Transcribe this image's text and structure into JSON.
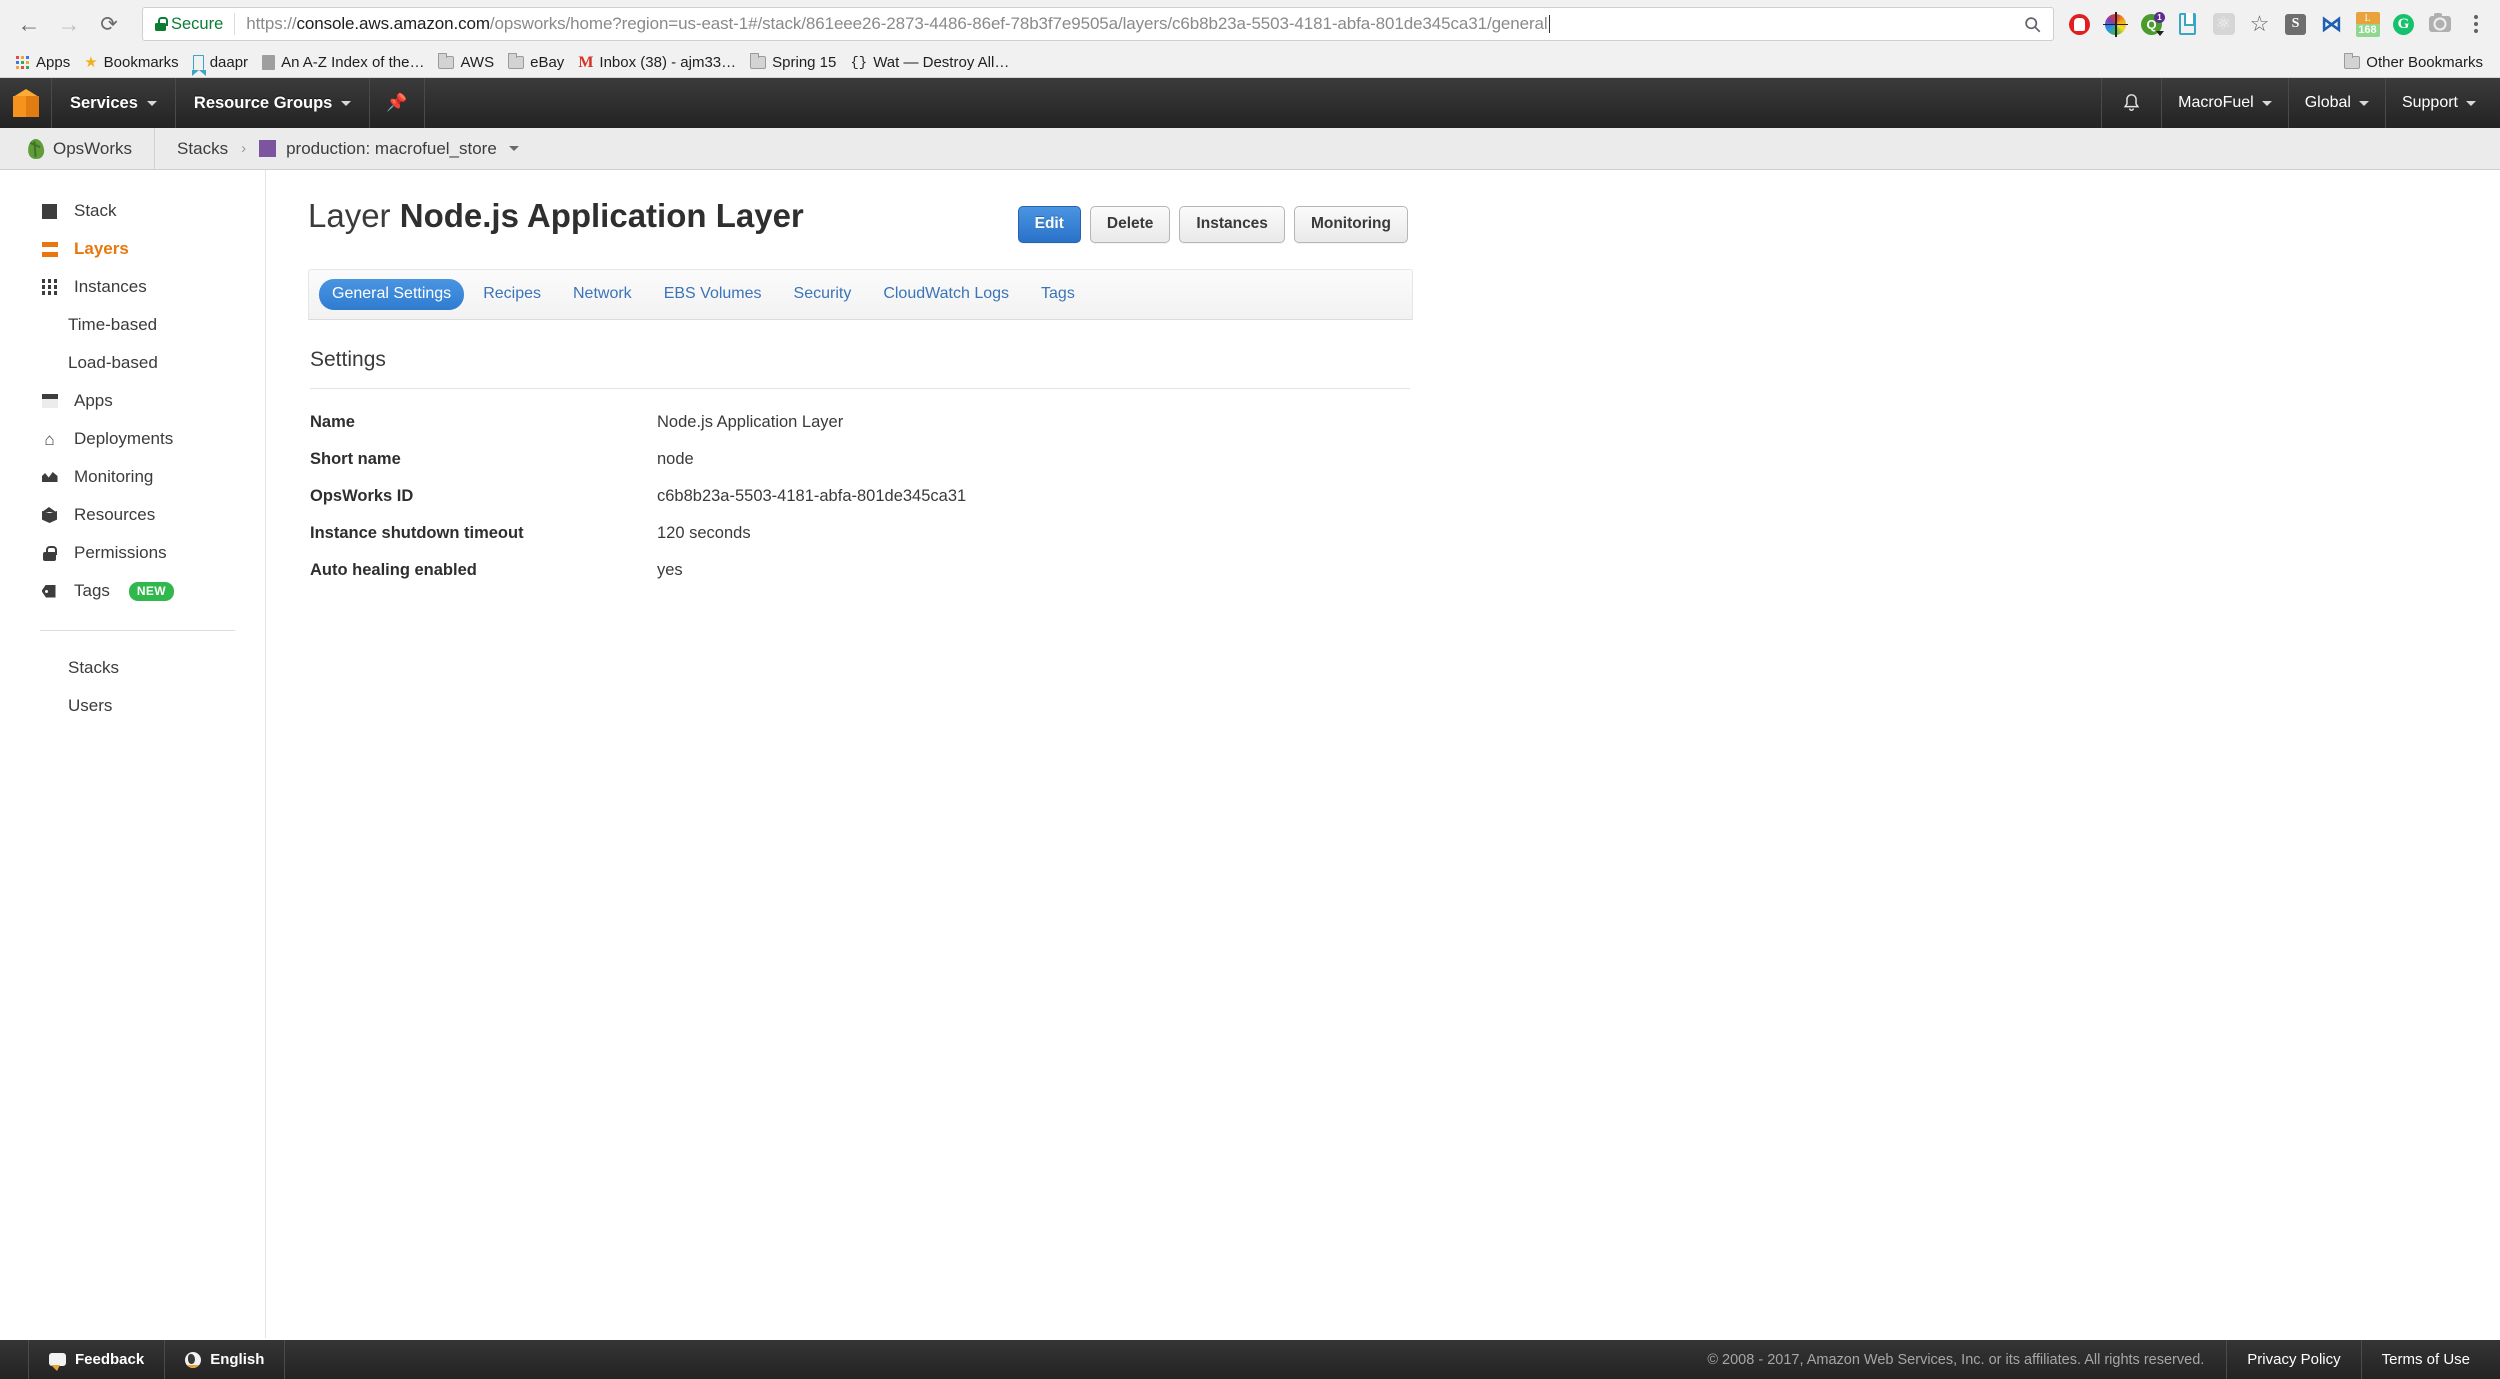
{
  "browser": {
    "back_icon": "←",
    "forward_icon": "→",
    "reload_icon": "⟳",
    "secure_label": "Secure",
    "url_host": "console.aws.amazon.com",
    "url_scheme": "https://",
    "url_path": "/opsworks/home?region=us-east-1#/stack/861eee26-2873-4486-86ef-78b3f7e9505a/layers/c6b8b23a-5503-4181-abfa-801de345ca31/general",
    "omnibox_search_icon": "search-icon",
    "extensions": [
      {
        "name": "adblock-stop-icon"
      },
      {
        "name": "color-picker-icon"
      },
      {
        "name": "quickbooks-icon",
        "badge": "1"
      },
      {
        "name": "pocket-bookmark-icon"
      },
      {
        "name": "react-devtools-icon",
        "glyph": "⚛"
      },
      {
        "name": "bookmark-star-icon",
        "glyph": "☆"
      },
      {
        "name": "scribd-icon",
        "glyph": "S"
      },
      {
        "name": "crossbrowser-icon",
        "glyph": "⋈"
      },
      {
        "name": "lastpass-icon",
        "glyph": "L",
        "badge": "168"
      },
      {
        "name": "grammarly-icon",
        "glyph": "G"
      },
      {
        "name": "screenshot-camera-icon"
      },
      {
        "name": "chrome-menu-icon"
      }
    ]
  },
  "bookmarks": {
    "items": [
      {
        "label": "Apps",
        "icon": "apps-grid-icon"
      },
      {
        "label": "Bookmarks",
        "icon": "star-icon"
      },
      {
        "label": "daapr",
        "icon": "ribbon-icon"
      },
      {
        "label": "An A-Z Index of the…",
        "icon": "page-icon"
      },
      {
        "label": "AWS",
        "icon": "folder-icon"
      },
      {
        "label": "eBay",
        "icon": "folder-icon"
      },
      {
        "label": "Inbox (38) - ajm33…",
        "icon": "gmail-icon"
      },
      {
        "label": "Spring 15",
        "icon": "folder-icon"
      },
      {
        "label": "Wat — Destroy All…",
        "icon": "braces-icon"
      }
    ],
    "other_label": "Other Bookmarks",
    "other_icon": "folder-icon"
  },
  "aws_nav": {
    "logo_icon": "aws-cube-icon",
    "services_label": "Services",
    "resource_groups_label": "Resource Groups",
    "pin_icon": "pin-icon",
    "bell_icon": "bell-icon",
    "account_label": "MacroFuel",
    "region_label": "Global",
    "support_label": "Support"
  },
  "ops_header": {
    "brand_icon": "chef-leaf-icon",
    "brand_label": "OpsWorks",
    "crumb_stacks": "Stacks",
    "crumb_separator": "›",
    "stack_swatch_color": "#7b569f",
    "crumb_stack_name": "production: macrofuel_store"
  },
  "sidebar": {
    "items": [
      {
        "label": "Stack",
        "icon": "stack-icon",
        "active": false
      },
      {
        "label": "Layers",
        "icon": "layers-icon",
        "active": true
      },
      {
        "label": "Instances",
        "icon": "instances-grid-icon",
        "active": false
      },
      {
        "label": "Time-based",
        "icon": "",
        "active": false,
        "sub": true
      },
      {
        "label": "Load-based",
        "icon": "",
        "active": false,
        "sub": true
      },
      {
        "label": "Apps",
        "icon": "apps-icon",
        "active": false
      },
      {
        "label": "Deployments",
        "icon": "deployments-icon",
        "active": false
      },
      {
        "label": "Monitoring",
        "icon": "monitoring-icon",
        "active": false
      },
      {
        "label": "Resources",
        "icon": "resources-cube-icon",
        "active": false
      },
      {
        "label": "Permissions",
        "icon": "lock-icon",
        "active": false
      },
      {
        "label": "Tags",
        "icon": "tag-icon",
        "active": false,
        "badge": "NEW"
      }
    ],
    "bottom_items": [
      {
        "label": "Stacks"
      },
      {
        "label": "Users"
      }
    ],
    "active_color": "#e8770d",
    "badge_color": "#31b84c"
  },
  "page": {
    "title_prefix": "Layer",
    "title_name": "Node.js Application Layer",
    "actions": [
      {
        "label": "Edit",
        "primary": true
      },
      {
        "label": "Delete",
        "primary": false
      },
      {
        "label": "Instances",
        "primary": false
      },
      {
        "label": "Monitoring",
        "primary": false
      }
    ],
    "primary_button_color": "#3580d6",
    "tabs": [
      {
        "label": "General Settings",
        "active": true
      },
      {
        "label": "Recipes",
        "active": false
      },
      {
        "label": "Network",
        "active": false
      },
      {
        "label": "EBS Volumes",
        "active": false
      },
      {
        "label": "Security",
        "active": false
      },
      {
        "label": "CloudWatch Logs",
        "active": false
      },
      {
        "label": "Tags",
        "active": false
      }
    ],
    "panel_title": "Settings",
    "settings": [
      {
        "key": "Name",
        "value": "Node.js Application Layer"
      },
      {
        "key": "Short name",
        "value": "node"
      },
      {
        "key": "OpsWorks ID",
        "value": "c6b8b23a-5503-4181-abfa-801de345ca31"
      },
      {
        "key": "Instance shutdown timeout",
        "value": "120 seconds"
      },
      {
        "key": "Auto healing enabled",
        "value": "yes"
      }
    ]
  },
  "footer": {
    "feedback_label": "Feedback",
    "language_label": "English",
    "copyright": "© 2008 - 2017, Amazon Web Services, Inc. or its affiliates. All rights reserved.",
    "privacy_label": "Privacy Policy",
    "terms_label": "Terms of Use"
  }
}
